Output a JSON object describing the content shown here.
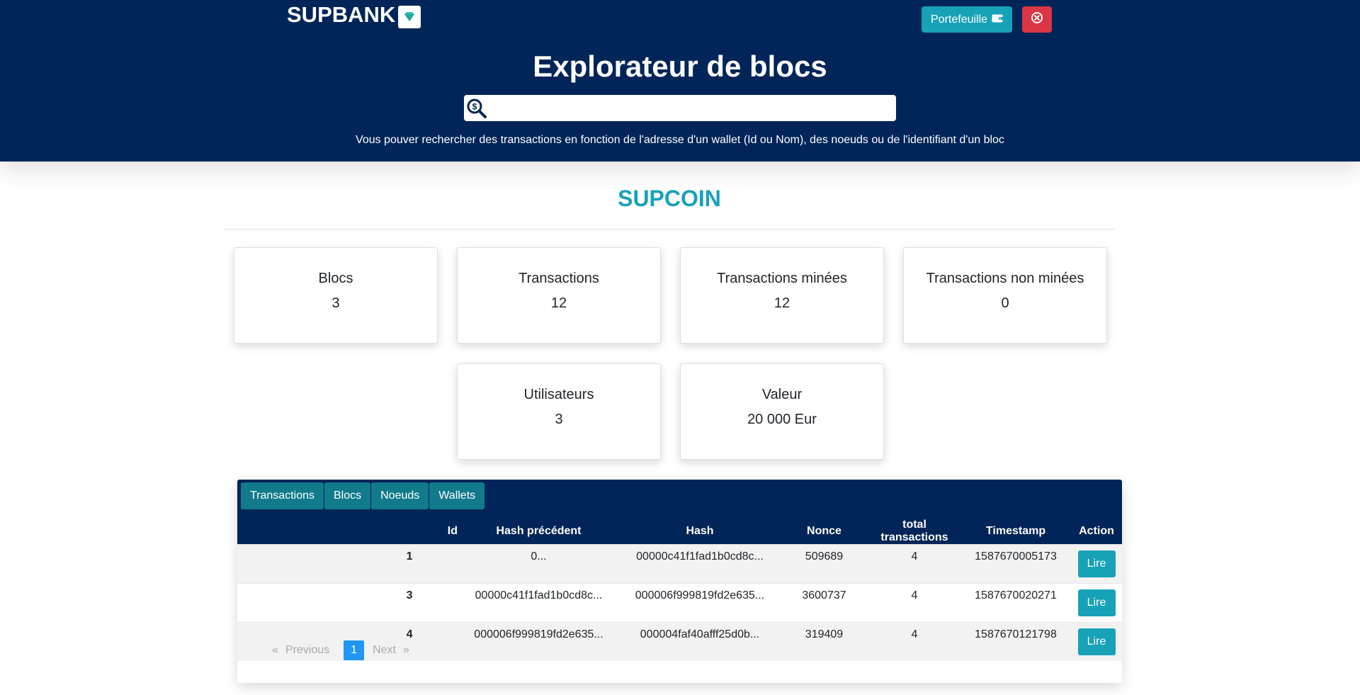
{
  "header": {
    "brand": "SUPBANK",
    "wallet_button": "Portefeuille",
    "title": "Explorateur de blocs",
    "search": {
      "placeholder": "",
      "value": ""
    },
    "help_text": "Vous pouver rechercher des transactions en fonction de l'adresse d'un wallet (Id ou Nom), des noeuds ou de l'identifiant d'un bloc"
  },
  "section_title": "SUPCOIN",
  "stats": [
    {
      "label": "Blocs",
      "value": "3"
    },
    {
      "label": "Transactions",
      "value": "12"
    },
    {
      "label": "Transactions minées",
      "value": "12"
    },
    {
      "label": "Transactions non minées",
      "value": "0"
    },
    {
      "label": "Utilisateurs",
      "value": "3"
    },
    {
      "label": "Valeur",
      "value": "20 000 Eur"
    }
  ],
  "tabs": [
    "Transactions",
    "Blocs",
    "Noeuds",
    "Wallets"
  ],
  "table": {
    "columns": [
      "Id",
      "Hash précédent",
      "Hash",
      "Nonce",
      "total transactions",
      "Timestamp",
      "Action"
    ],
    "rows": [
      {
        "id": "1",
        "prev_hash": "0...",
        "hash": "00000c41f1fad1b0cd8c...",
        "nonce": "509689",
        "total": "4",
        "timestamp": "1587670005173",
        "action": "Lire"
      },
      {
        "id": "3",
        "prev_hash": "00000c41f1fad1b0cd8c...",
        "hash": "000006f999819fd2e635...",
        "nonce": "3600737",
        "total": "4",
        "timestamp": "1587670020271",
        "action": "Lire"
      },
      {
        "id": "4",
        "prev_hash": "000006f999819fd2e635...",
        "hash": "000004faf40afff25d0b...",
        "nonce": "319409",
        "total": "4",
        "timestamp": "1587670121798",
        "action": "Lire"
      }
    ]
  },
  "pagination": {
    "first": "«",
    "previous": "Previous",
    "current": "1",
    "next": "Next",
    "last": "»"
  },
  "colors": {
    "navy": "#012558",
    "teal": "#17a2b8",
    "tab": "#117a8b",
    "danger": "#dc3545",
    "page_active": "#2196f3"
  },
  "icons": {
    "logo": "diamond-icon",
    "wallet": "wallet-icon",
    "close": "close-circle-icon",
    "search": "dollar-search-icon"
  }
}
